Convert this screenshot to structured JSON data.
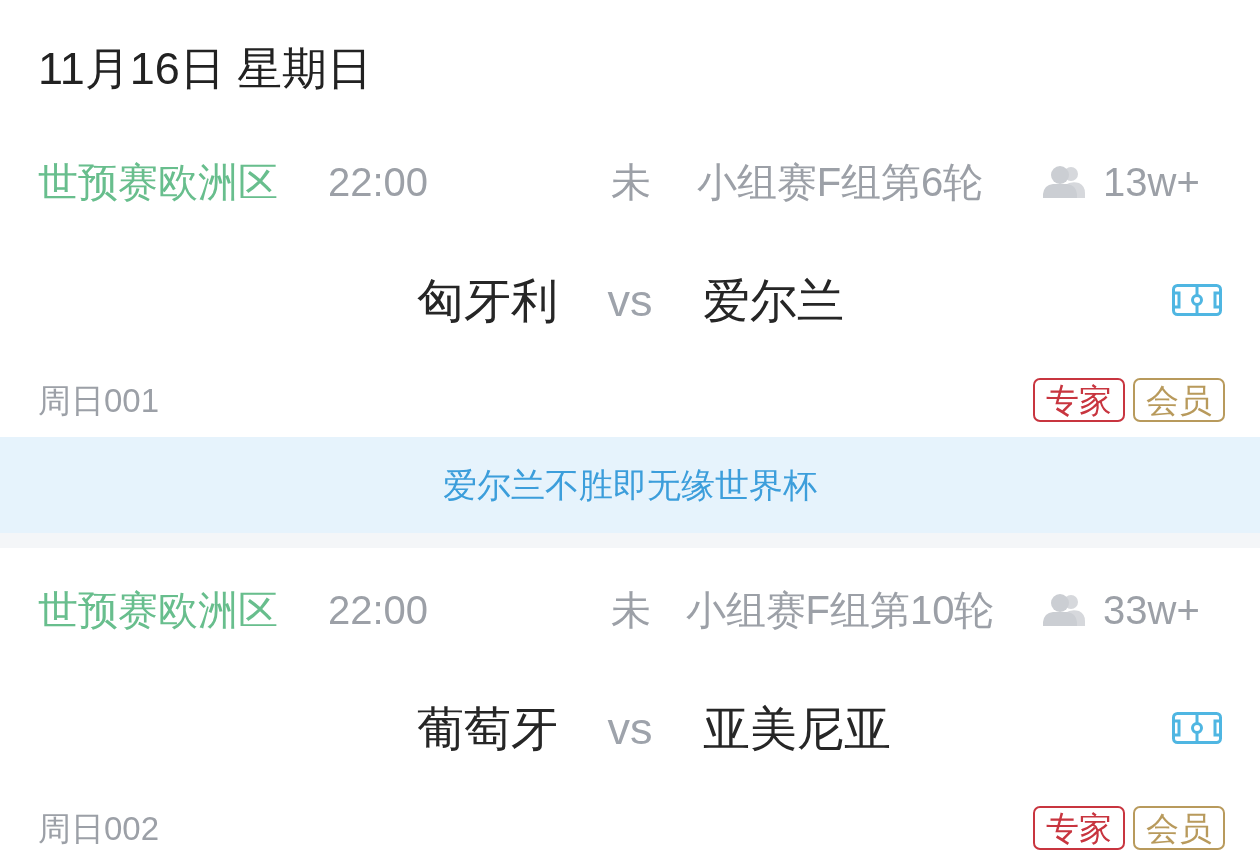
{
  "date_header": "11月16日 星期日",
  "matches": [
    {
      "league": "世预赛欧洲区",
      "time": "22:00",
      "status": "未",
      "round": "小组赛F组第6轮",
      "followers": "13w+",
      "home_team": "匈牙利",
      "vs": "vs",
      "away_team": "爱尔兰",
      "match_code": "周日001",
      "tags": [
        {
          "label": "专家",
          "color": "#c8353f"
        },
        {
          "label": "会员",
          "color": "#b89a5c"
        }
      ],
      "banner": "爱尔兰不胜即无缘世界杯"
    },
    {
      "league": "世预赛欧洲区",
      "time": "22:00",
      "status": "未",
      "round": "小组赛F组第10轮",
      "followers": "33w+",
      "home_team": "葡萄牙",
      "vs": "vs",
      "away_team": "亚美尼亚",
      "match_code": "周日002",
      "tags": [
        {
          "label": "专家",
          "color": "#c8353f"
        },
        {
          "label": "会员",
          "color": "#b89a5c"
        }
      ]
    }
  ]
}
